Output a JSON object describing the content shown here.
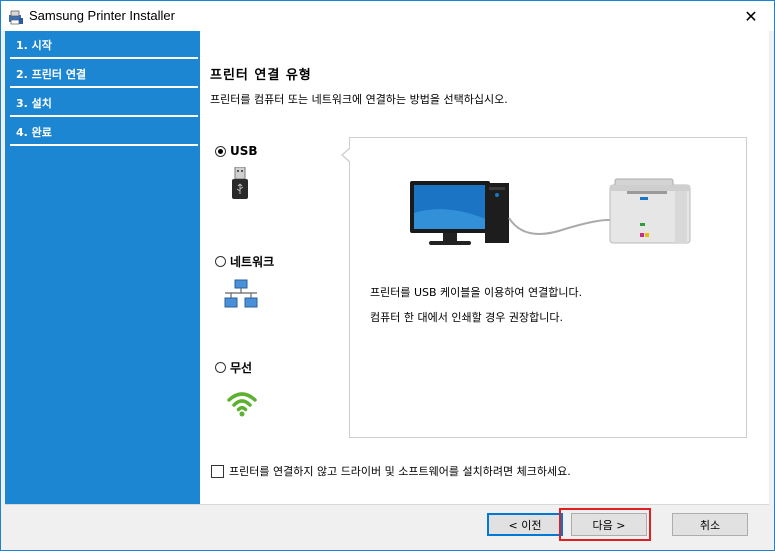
{
  "window": {
    "title": "Samsung Printer Installer",
    "close_glyph": "✕"
  },
  "sidebar": {
    "steps": [
      {
        "label": "1. 시작"
      },
      {
        "label": "2. 프린터 연결"
      },
      {
        "label": "3. 설치"
      },
      {
        "label": "4. 완료"
      }
    ],
    "active_index": 1
  },
  "main": {
    "heading": "프린터 연결 유형",
    "subtitle": "프린터를 컴퓨터 또는 네트워크에 연결하는 방법을 선택하십시오.",
    "options": [
      {
        "label": "USB",
        "icon": "usb-icon",
        "selected": true
      },
      {
        "label": "네트워크",
        "icon": "network-icon",
        "selected": false
      },
      {
        "label": "무선",
        "icon": "wifi-icon",
        "selected": false
      }
    ],
    "panel": {
      "line1": "프린터를 USB 케이블을 이용하여 연결합니다.",
      "line2": "컴퓨터 한 대에서 인쇄할 경우 권장합니다."
    },
    "skip_checkbox": {
      "label": "프린터를 연결하지 않고 드라이버 및 소프트웨어를 설치하려면 체크하세요.",
      "checked": false
    }
  },
  "footer": {
    "back_label": "< 이전",
    "next_label": "다음 >",
    "cancel_label": "취소"
  },
  "colors": {
    "sidebar": "#1d86d2",
    "accent": "#0078d7",
    "highlight": "#e02020"
  }
}
